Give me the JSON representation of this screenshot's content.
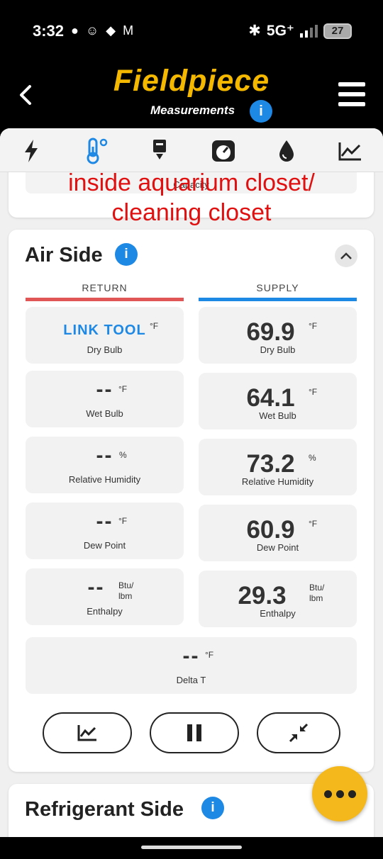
{
  "status": {
    "time": "3:32",
    "network": "5G⁺",
    "battery": "27"
  },
  "header": {
    "brand": "Fieldpiece",
    "subtitle": "Measurements",
    "info_glyph": "i"
  },
  "tabs": [
    {
      "name": "electrical-icon"
    },
    {
      "name": "temperature-icon",
      "active": true
    },
    {
      "name": "download-tool-icon"
    },
    {
      "name": "gauge-icon"
    },
    {
      "name": "water-drop-icon"
    },
    {
      "name": "trend-chart-icon"
    }
  ],
  "capacity_label": "Capacity",
  "note": {
    "line1": "inside aquarium closet/",
    "line2": "cleaning closet"
  },
  "air_side": {
    "title": "Air Side",
    "return_label": "RETURN",
    "supply_label": "SUPPLY",
    "return": {
      "dry_bulb": {
        "value": "LINK TOOL",
        "unit": "°F",
        "label": "Dry Bulb"
      },
      "wet_bulb": {
        "value": "--",
        "unit": "°F",
        "label": "Wet Bulb"
      },
      "rh": {
        "value": "--",
        "unit": "%",
        "label": "Relative Humidity"
      },
      "dew_point": {
        "value": "--",
        "unit": "°F",
        "label": "Dew Point"
      },
      "enthalpy": {
        "value": "--",
        "unit1": "Btu/",
        "unit2": "lbm",
        "label": "Enthalpy"
      }
    },
    "supply": {
      "dry_bulb": {
        "value": "69.9",
        "unit": "°F",
        "label": "Dry Bulb"
      },
      "wet_bulb": {
        "value": "64.1",
        "unit": "°F",
        "label": "Wet Bulb"
      },
      "rh": {
        "value": "73.2",
        "unit": "%",
        "label": "Relative Humidity"
      },
      "dew_point": {
        "value": "60.9",
        "unit": "°F",
        "label": "Dew Point"
      },
      "enthalpy": {
        "value": "29.3",
        "unit1": "Btu/",
        "unit2": "lbm",
        "label": "Enthalpy"
      }
    },
    "delta_t": {
      "value": "--",
      "unit": "°F",
      "label": "Delta T"
    }
  },
  "refrigerant_side": {
    "title": "Refrigerant Side"
  },
  "colors": {
    "brand": "#f5b800",
    "return": "#e05555",
    "supply": "#1e88e5",
    "fab": "#f5b81c"
  }
}
